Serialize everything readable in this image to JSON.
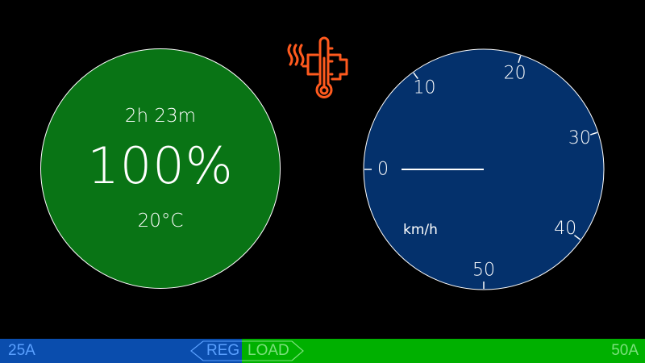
{
  "battery": {
    "time_remaining": "2h 23m",
    "charge_percent": "100%",
    "temperature": "20°C",
    "color": "#097415"
  },
  "warning": {
    "icon": "motor-temperature-warning-icon",
    "color": "#ff5a1e"
  },
  "speedometer": {
    "unit": "km/h",
    "ticks": [
      "0",
      "10",
      "20",
      "30",
      "40",
      "50"
    ],
    "min": 0,
    "max": 50,
    "value": 0,
    "color": "#04316c"
  },
  "current_bar": {
    "regen_max": "25A",
    "regen_label": "REG",
    "load_label": "LOAD",
    "load_max": "50A",
    "regen_color": "#0a4dad",
    "load_color": "#00b000"
  }
}
